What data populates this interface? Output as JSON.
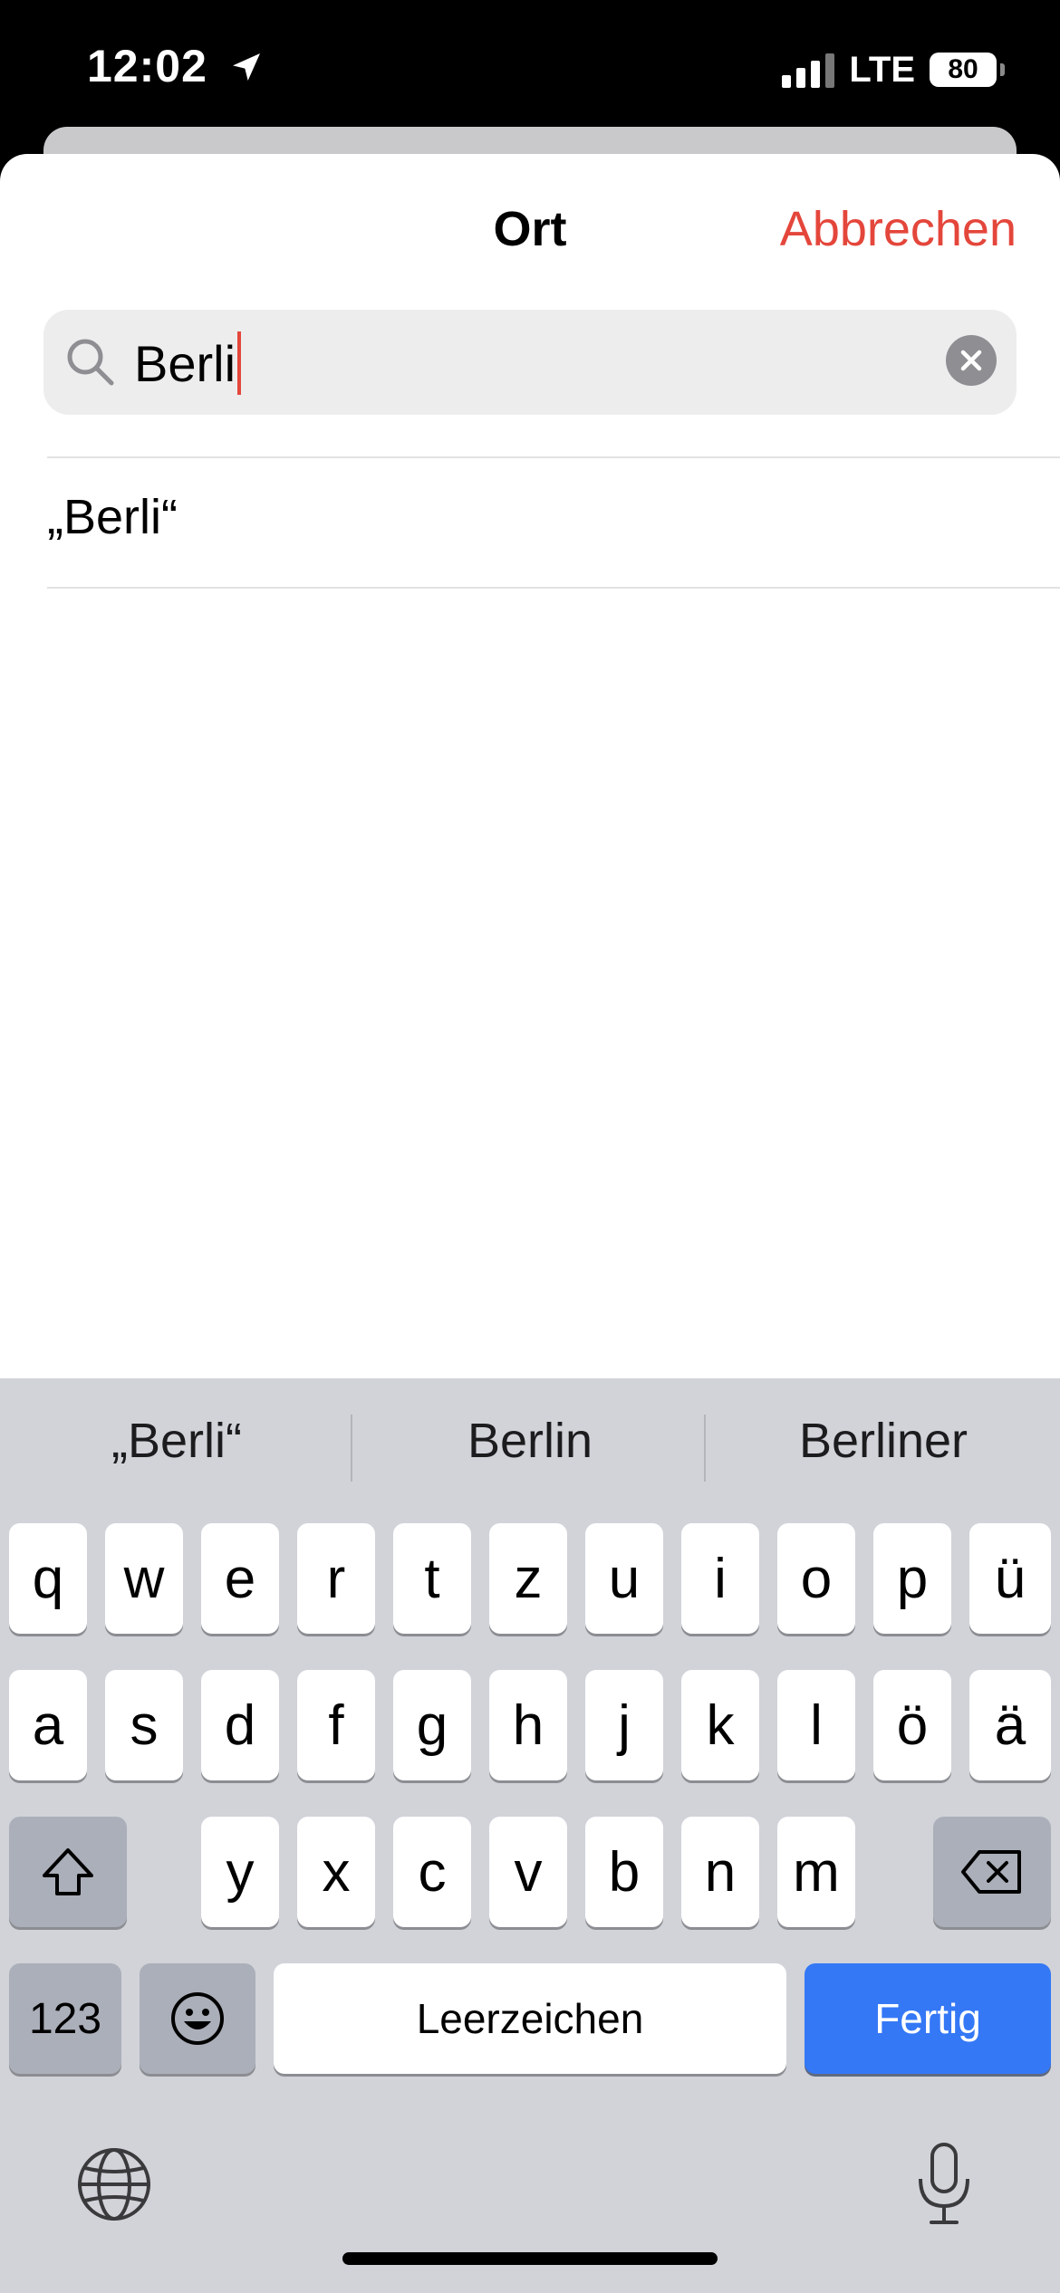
{
  "status": {
    "time": "12:02",
    "network": "LTE",
    "battery": "80"
  },
  "sheet": {
    "title": "Ort",
    "cancel_label": "Abbrechen"
  },
  "search": {
    "value": "Berli"
  },
  "results": [
    {
      "label": "„Berli“"
    }
  ],
  "keyboard": {
    "suggestions": [
      "„Berli“",
      "Berlin",
      "Berliner"
    ],
    "row1": [
      "q",
      "w",
      "e",
      "r",
      "t",
      "z",
      "u",
      "i",
      "o",
      "p",
      "ü"
    ],
    "row2": [
      "a",
      "s",
      "d",
      "f",
      "g",
      "h",
      "j",
      "k",
      "l",
      "ö",
      "ä"
    ],
    "row3": [
      "y",
      "x",
      "c",
      "v",
      "b",
      "n",
      "m"
    ],
    "numbers_label": "123",
    "space_label": "Leerzeichen",
    "done_label": "Fertig"
  },
  "colors": {
    "accent_red": "#e4463b",
    "done_blue": "#3478f6",
    "keyboard_bg": "#d1d3d9"
  }
}
